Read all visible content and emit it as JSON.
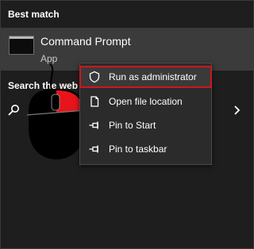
{
  "best_match": {
    "header": "Best match",
    "app": {
      "name": "Command Prompt",
      "type": "App",
      "icon": "command-prompt-icon"
    }
  },
  "search_web": {
    "header": "Search the web",
    "icon": "search-icon"
  },
  "context_menu": {
    "items": [
      {
        "label": "Run as administrator",
        "icon": "shield-icon",
        "highlighted": true
      },
      {
        "label": "Open file location",
        "icon": "file-icon"
      },
      {
        "label": "Pin to Start",
        "icon": "pin-icon"
      },
      {
        "label": "Pin to taskbar",
        "icon": "pin-icon"
      }
    ]
  },
  "colors": {
    "background": "#1e1e1e",
    "selected_row": "#3b3b3b",
    "menu": "#2b2b2b",
    "highlight_border": "#d0151d",
    "mouse_button_highlight": "#e8141b"
  }
}
